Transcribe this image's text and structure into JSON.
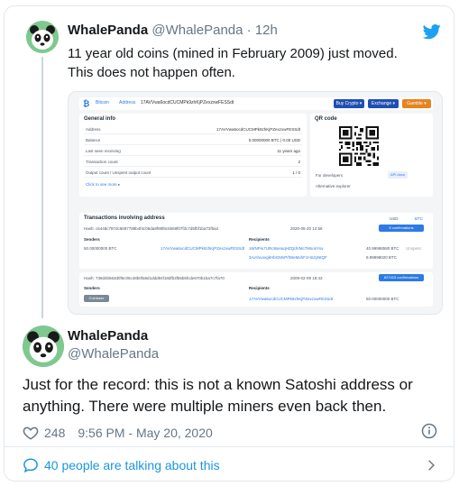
{
  "parent_tweet": {
    "name": "WhalePanda",
    "handle": "@WhalePanda",
    "separator": "·",
    "time": "12h",
    "text_line1": "11 year old coins (mined in February 2009) just moved.",
    "text_line2": "This does not happen often.",
    "media": {
      "breadcrumb": [
        "Bitcoin",
        "Address",
        "17AVVwa6ocdCUCMPk9zhKjPZexzxwFESSdt"
      ],
      "buttons": [
        {
          "label": "Buy Crypto ▾",
          "color": "#1f4fb3"
        },
        {
          "label": "Exchange ▾",
          "color": "#1f4fb3"
        },
        {
          "label": "Gamble ▾",
          "color": "#e8831e"
        }
      ],
      "general_info": {
        "title": "General info",
        "rows": [
          {
            "k": "Address",
            "v": "17AVVwa6ocdCUCMPk9zhKjPZexzxwFESSdt"
          },
          {
            "k": "Balance",
            "v": "0.00000000 BTC | 0.00 USD"
          },
          {
            "k": "Last seen receiving",
            "v": "11 years ago"
          },
          {
            "k": "Transaction count",
            "v": "2"
          },
          {
            "k": "Output count / Unspent output count",
            "v": "1 / 0"
          }
        ],
        "see_more": "Click to see more ▸"
      },
      "qr_code": {
        "title": "QR code",
        "for_developers": "For developers",
        "api_docs": "API docs",
        "alternative_explorer": "Alternative explorer"
      },
      "transactions": {
        "title": "Transactions involving address",
        "toggle_usd": "USD",
        "toggle_btc": "BTC",
        "tx1": {
          "hash": "Hash: c5448c787dc6697788b4f4c06da8f95f8c5b69f07f3c7d5fbf1ba72f5a4",
          "date": "2020-05-20 12:56",
          "confirmations": "5 confirmations",
          "senders_label": "Senders",
          "recipients_label": "Recipients",
          "sender_amount": "50.00000000 BTC",
          "sender_addr": "17AVVwa6ocdCUCMPk9zhKjPZexzxwFESSdt",
          "recipient1": "16rNPiu7URc8aHuqHZQdVMc7MsonYov",
          "recipient1_amount": "40.99998580 BTC",
          "recipient1_status": "Unspent",
          "recipient2": "3AiAhuoxgkHbGMvPrfWeMxhF1Hn2yNtQF",
          "recipient2_amount": "9.99998020 BTC"
        },
        "tx2": {
          "hash": "Hash: 738d4b563d0f6c05c48b0fa8d1ddd94f18dfb3f55b5fcde670b1ba7c7fa70",
          "date": "2009-02-09 18:43",
          "confirmations": "627415 confirmations",
          "senders_label": "Senders",
          "recipients_label": "Recipients",
          "sender": "Coinbase",
          "recipient": "17AVVwa6ocdCUCMPk9zhKjPZexzxwFESSdt",
          "amount": "50.00000000 BTC"
        }
      }
    }
  },
  "main_tweet": {
    "name": "WhalePanda",
    "handle": "@WhalePanda",
    "text": "Just for the record: this is not a known Satoshi address or anything. There were multiple miners even back then.",
    "likes": "248",
    "timestamp": "9:56 PM - May 20, 2020",
    "talking": "40 people are talking about this"
  },
  "colors": {
    "twitter_blue": "#1da1f2",
    "link_blue": "#1b95e0",
    "muted": "#657786",
    "avatar_green": "#7fc88f"
  }
}
